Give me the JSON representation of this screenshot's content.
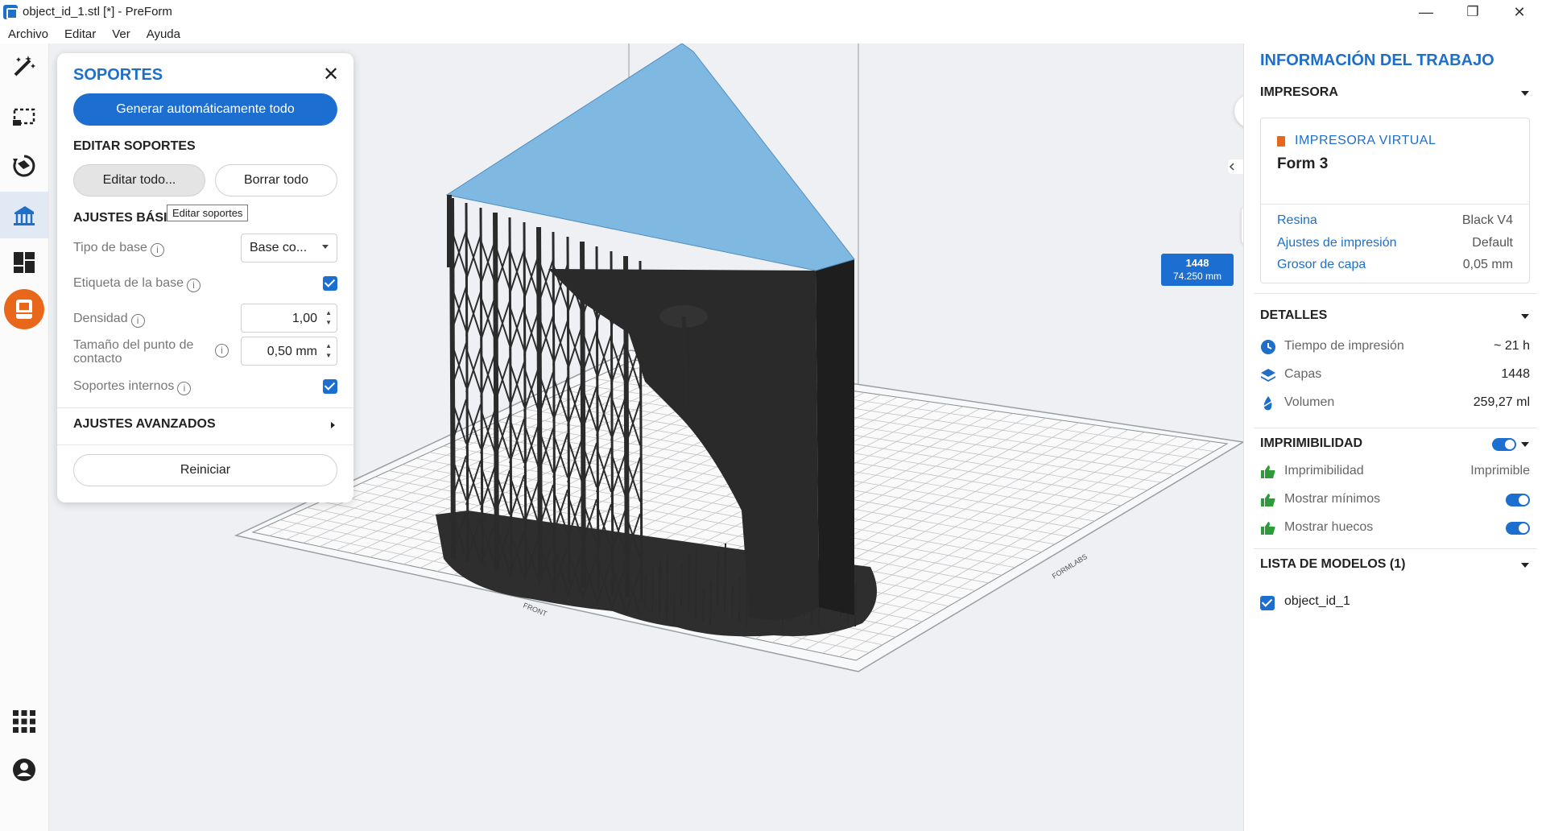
{
  "window": {
    "title": "object_id_1.stl [*] - PreForm",
    "minimize": "—",
    "restore": "❐",
    "close": "✕"
  },
  "menu": [
    "Archivo",
    "Editar",
    "Ver",
    "Ayuda"
  ],
  "toolbar": {
    "tools": [
      "magic-wand-icon",
      "select-box-icon",
      "orient-icon",
      "supports-icon",
      "layout-icon",
      "print-icon",
      "apps-grid-icon",
      "account-icon"
    ],
    "active": "supports-icon",
    "accent": "#e8671a"
  },
  "supports_panel": {
    "title": "SOPORTES",
    "close": "✕",
    "generate_all": "Generar automáticamente todo",
    "edit_section": "EDITAR SOPORTES",
    "edit_all": "Editar todo...",
    "delete_all": "Borrar todo",
    "tooltip": "Editar soportes",
    "basic_section": "AJUSTES BÁSICOS",
    "base_type_label": "Tipo de base",
    "base_type_value": "Base co...",
    "base_label_label": "Etiqueta de la base",
    "base_label_checked": true,
    "density_label": "Densidad",
    "density_value": "1,00",
    "touchpoint_label_1": "Tamaño del punto de",
    "touchpoint_label_2": "contacto",
    "touchpoint_value": "0,50 mm",
    "internal_label": "Soportes internos",
    "internal_checked": true,
    "advanced_section": "AJUSTES AVANZADOS",
    "reset": "Reiniciar"
  },
  "viewport": {
    "layer_count": "1448",
    "layer_height": "74.250 mm",
    "platform_front_label": "FRONT",
    "platform_side_label": "FORMLABS",
    "zoom_in": "+",
    "zoom_out": "−",
    "model_color": "#2b2b2b",
    "selected_face_color": "#7fb8e0"
  },
  "job_info": {
    "title": "INFORMACIÓN DEL TRABAJO",
    "printer_section": "IMPRESORA",
    "printer_type": "IMPRESORA VIRTUAL",
    "printer_name": "Form 3",
    "resin_label": "Resina",
    "resin_value": "Black V4",
    "settings_label": "Ajustes de impresión",
    "settings_value": "Default",
    "layer_label": "Grosor de capa",
    "layer_value": "0,05 mm",
    "details_section": "DETALLES",
    "time_label": "Tiempo de impresión",
    "time_value": "~ 21 h",
    "layers_label": "Capas",
    "layers_value": "1448",
    "volume_label": "Volumen",
    "volume_value": "259,27 ml",
    "printability_section": "IMPRIMIBILIDAD",
    "printability_label": "Imprimibilidad",
    "printability_value": "Imprimible",
    "show_min_label": "Mostrar mínimos",
    "show_holes_label": "Mostrar huecos",
    "models_section": "LISTA DE MODELOS (1)",
    "model_name": "object_id_1",
    "accent": "#1f6fc9",
    "good_color": "#2e9b3a"
  }
}
